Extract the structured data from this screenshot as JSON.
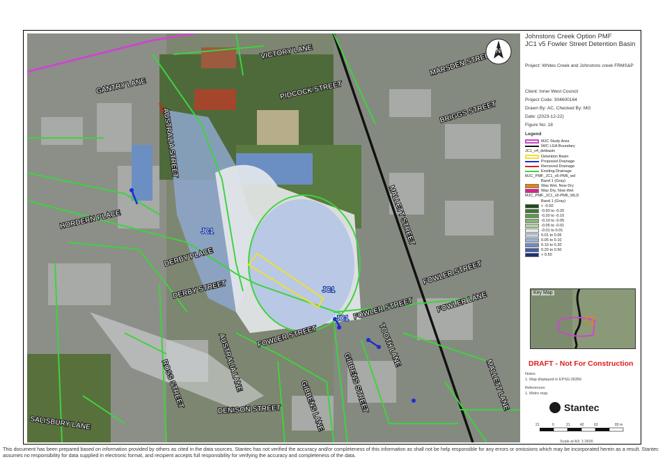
{
  "title_lines": [
    "Johnstons Creek Option PMF",
    "JC1 v5 Fowler Street Detention Basin"
  ],
  "project": "Project: Whites Creek and Johnstons creek FRMS&P",
  "client": "Client: Inner West Council",
  "project_code": "Project Code: 304600164",
  "drawn_by": "Drawn By: AC, Checked By: MG",
  "date": "Date: (2023-12-22)",
  "figure_no": "Figure No: 18",
  "legend": {
    "title": "Legend",
    "items": [
      {
        "label": "MJC Study Area",
        "color": "#c94ac9",
        "style": "outline"
      },
      {
        "label": "IWC LGA Boundary",
        "color": "#111111",
        "style": "line"
      },
      {
        "label": "JC1_v4_detbasin",
        "color": "",
        "style": "header"
      },
      {
        "label": "Detention Basin",
        "color": "#f0e030",
        "style": "outline"
      },
      {
        "label": "Proposed Drainage",
        "color": "#1d2fd0",
        "style": "line"
      },
      {
        "label": "Removed Drainage",
        "color": "#e01b1b",
        "style": "line"
      },
      {
        "label": "Existing Drainage",
        "color": "#3fd23f",
        "style": "line"
      },
      {
        "label": "MJC_PMF_JC1_v5-PM6_wd",
        "color": "",
        "style": "header"
      },
      {
        "label": "Band 1 (Gray)",
        "color": "",
        "style": "sub"
      },
      {
        "label": "Was Wet, Now Dry",
        "color": "#e8801a",
        "style": "fill"
      },
      {
        "label": "Was Dry, Now Wet",
        "color": "#e0208a",
        "style": "fill"
      },
      {
        "label": "MJC_PMF_JC1_v5-PM6_WLD",
        "color": "",
        "style": "header"
      },
      {
        "label": "Band 1 (Gray)",
        "color": "",
        "style": "sub"
      },
      {
        "label": "< -0.50",
        "color": "#1e4a16",
        "style": "fill"
      },
      {
        "label": "-0.50 to -0.20",
        "color": "#3a7a2a",
        "style": "fill"
      },
      {
        "label": "-0.20 to -0.10",
        "color": "#5c9a4a",
        "style": "fill"
      },
      {
        "label": "-0.10 to -0.05",
        "color": "#86b872",
        "style": "fill"
      },
      {
        "label": "-0.05 to -0.01",
        "color": "#b4d4a4",
        "style": "fill"
      },
      {
        "label": "-0.01 to 0.01",
        "color": "#ececec",
        "style": "fill"
      },
      {
        "label": "0.01 to 0.05",
        "color": "#c6d2e6",
        "style": "fill"
      },
      {
        "label": "0.05 to 0.10",
        "color": "#9fb3d6",
        "style": "fill"
      },
      {
        "label": "0.10 to 0.20",
        "color": "#6f8cc2",
        "style": "fill"
      },
      {
        "label": "0.20 to 0.50",
        "color": "#3f5ea4",
        "style": "fill"
      },
      {
        "label": "> 0.50",
        "color": "#1c2f78",
        "style": "fill"
      }
    ]
  },
  "keymap_label": "Key Map",
  "draft_notice": "DRAFT - Not For Construction",
  "notes_title": "Notes:",
  "notes_text": "1. Map displayed in EPSG:28356",
  "references_title": "References:",
  "references_text": "1. Metro map",
  "company": "Stantec",
  "scale_ticks": [
    "21",
    "0",
    "21",
    "42",
    "63",
    "83 m"
  ],
  "scale_text": "Scale at A3: 1:2600",
  "north_label": "N",
  "disclaimer": "This document has been prepared based on information provided by others as cited in the data sources. Stantec has not verified the accuracy and/or completeness of this information as shall not be help responsible for any errors or omissions which may be incorporated herein as a result. Stantec assumes no responsibility for data supplied in electronic format, and recipient accepts full responsibility for verifying the accuracy and completeness of the data.",
  "streets": {
    "victory_lane": "VICTORY LANE",
    "marsden_street": "MARSDEN STREET",
    "gantry_lane": "GANTRY LANE",
    "pidcock_street": "PIDCOCK STREET",
    "briggs_street": "BRIGGS STREET",
    "australia_street_n": "AUSTRALIA STREET",
    "mallett_street_n": "MALLETT STREET",
    "hordern_place": "HORDERN PLACE",
    "derby_place": "DERBY PLACE",
    "derby_street": "DERBY STREET",
    "fowler_street_e": "FOWLER STREET",
    "fowler_street_mid": "FOWLER STREET",
    "fowler_street_sw": "FOWLER STREET",
    "fowler_lane": "FOWLER LANE",
    "tooth_lane": "TOOTH LANE",
    "gibbens_street": "GIBBENS STREET",
    "gibbens_lane": "GIBBENS LANE",
    "australia_lane": "AUSTRALIA LANE",
    "ross_street": "ROSS STREET",
    "denison_street": "DENISON STREET",
    "salisbury_lane": "SALISBURY LANE",
    "mallett_lane": "MALLETT LANE"
  },
  "map_labels": {
    "jc1_a": "JC1",
    "jc1_b": "JC1",
    "jc1_c": "JC1"
  }
}
